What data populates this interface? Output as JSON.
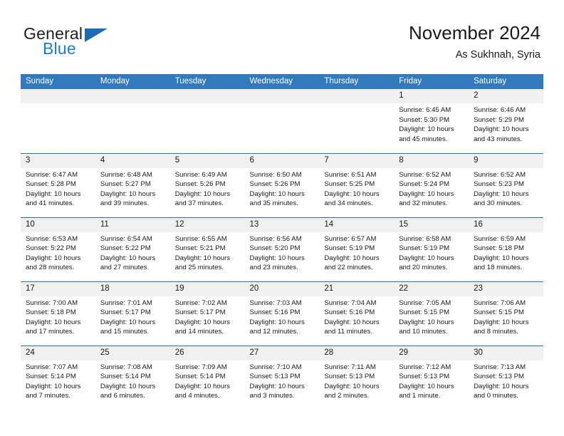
{
  "brand": {
    "word_one": "General",
    "word_two": "Blue",
    "triangle_icon": "blue-triangle-logo"
  },
  "header": {
    "month_title": "November 2024",
    "location": "As Sukhnah, Syria"
  },
  "colors": {
    "header_blue": "#3279bd",
    "daynum_grey": "#f0f0f0",
    "brand_blue": "#1c7fc4",
    "row_border": "#2f73b4"
  },
  "weekday_headers": [
    "Sunday",
    "Monday",
    "Tuesday",
    "Wednesday",
    "Thursday",
    "Friday",
    "Saturday"
  ],
  "weeks": [
    [
      {
        "day": "",
        "sunrise": "",
        "sunset": "",
        "daylight": "",
        "empty": true
      },
      {
        "day": "",
        "sunrise": "",
        "sunset": "",
        "daylight": "",
        "empty": true
      },
      {
        "day": "",
        "sunrise": "",
        "sunset": "",
        "daylight": "",
        "empty": true
      },
      {
        "day": "",
        "sunrise": "",
        "sunset": "",
        "daylight": "",
        "empty": true
      },
      {
        "day": "",
        "sunrise": "",
        "sunset": "",
        "daylight": "",
        "empty": true
      },
      {
        "day": "1",
        "sunrise": "Sunrise: 6:45 AM",
        "sunset": "Sunset: 5:30 PM",
        "daylight": "Daylight: 10 hours and 45 minutes.",
        "empty": false
      },
      {
        "day": "2",
        "sunrise": "Sunrise: 6:46 AM",
        "sunset": "Sunset: 5:29 PM",
        "daylight": "Daylight: 10 hours and 43 minutes.",
        "empty": false
      }
    ],
    [
      {
        "day": "3",
        "sunrise": "Sunrise: 6:47 AM",
        "sunset": "Sunset: 5:28 PM",
        "daylight": "Daylight: 10 hours and 41 minutes.",
        "empty": false
      },
      {
        "day": "4",
        "sunrise": "Sunrise: 6:48 AM",
        "sunset": "Sunset: 5:27 PM",
        "daylight": "Daylight: 10 hours and 39 minutes.",
        "empty": false
      },
      {
        "day": "5",
        "sunrise": "Sunrise: 6:49 AM",
        "sunset": "Sunset: 5:26 PM",
        "daylight": "Daylight: 10 hours and 37 minutes.",
        "empty": false
      },
      {
        "day": "6",
        "sunrise": "Sunrise: 6:50 AM",
        "sunset": "Sunset: 5:26 PM",
        "daylight": "Daylight: 10 hours and 35 minutes.",
        "empty": false
      },
      {
        "day": "7",
        "sunrise": "Sunrise: 6:51 AM",
        "sunset": "Sunset: 5:25 PM",
        "daylight": "Daylight: 10 hours and 34 minutes.",
        "empty": false
      },
      {
        "day": "8",
        "sunrise": "Sunrise: 6:52 AM",
        "sunset": "Sunset: 5:24 PM",
        "daylight": "Daylight: 10 hours and 32 minutes.",
        "empty": false
      },
      {
        "day": "9",
        "sunrise": "Sunrise: 6:52 AM",
        "sunset": "Sunset: 5:23 PM",
        "daylight": "Daylight: 10 hours and 30 minutes.",
        "empty": false
      }
    ],
    [
      {
        "day": "10",
        "sunrise": "Sunrise: 6:53 AM",
        "sunset": "Sunset: 5:22 PM",
        "daylight": "Daylight: 10 hours and 28 minutes.",
        "empty": false
      },
      {
        "day": "11",
        "sunrise": "Sunrise: 6:54 AM",
        "sunset": "Sunset: 5:22 PM",
        "daylight": "Daylight: 10 hours and 27 minutes.",
        "empty": false
      },
      {
        "day": "12",
        "sunrise": "Sunrise: 6:55 AM",
        "sunset": "Sunset: 5:21 PM",
        "daylight": "Daylight: 10 hours and 25 minutes.",
        "empty": false
      },
      {
        "day": "13",
        "sunrise": "Sunrise: 6:56 AM",
        "sunset": "Sunset: 5:20 PM",
        "daylight": "Daylight: 10 hours and 23 minutes.",
        "empty": false
      },
      {
        "day": "14",
        "sunrise": "Sunrise: 6:57 AM",
        "sunset": "Sunset: 5:19 PM",
        "daylight": "Daylight: 10 hours and 22 minutes.",
        "empty": false
      },
      {
        "day": "15",
        "sunrise": "Sunrise: 6:58 AM",
        "sunset": "Sunset: 5:19 PM",
        "daylight": "Daylight: 10 hours and 20 minutes.",
        "empty": false
      },
      {
        "day": "16",
        "sunrise": "Sunrise: 6:59 AM",
        "sunset": "Sunset: 5:18 PM",
        "daylight": "Daylight: 10 hours and 18 minutes.",
        "empty": false
      }
    ],
    [
      {
        "day": "17",
        "sunrise": "Sunrise: 7:00 AM",
        "sunset": "Sunset: 5:18 PM",
        "daylight": "Daylight: 10 hours and 17 minutes.",
        "empty": false
      },
      {
        "day": "18",
        "sunrise": "Sunrise: 7:01 AM",
        "sunset": "Sunset: 5:17 PM",
        "daylight": "Daylight: 10 hours and 15 minutes.",
        "empty": false
      },
      {
        "day": "19",
        "sunrise": "Sunrise: 7:02 AM",
        "sunset": "Sunset: 5:17 PM",
        "daylight": "Daylight: 10 hours and 14 minutes.",
        "empty": false
      },
      {
        "day": "20",
        "sunrise": "Sunrise: 7:03 AM",
        "sunset": "Sunset: 5:16 PM",
        "daylight": "Daylight: 10 hours and 12 minutes.",
        "empty": false
      },
      {
        "day": "21",
        "sunrise": "Sunrise: 7:04 AM",
        "sunset": "Sunset: 5:16 PM",
        "daylight": "Daylight: 10 hours and 11 minutes.",
        "empty": false
      },
      {
        "day": "22",
        "sunrise": "Sunrise: 7:05 AM",
        "sunset": "Sunset: 5:15 PM",
        "daylight": "Daylight: 10 hours and 10 minutes.",
        "empty": false
      },
      {
        "day": "23",
        "sunrise": "Sunrise: 7:06 AM",
        "sunset": "Sunset: 5:15 PM",
        "daylight": "Daylight: 10 hours and 8 minutes.",
        "empty": false
      }
    ],
    [
      {
        "day": "24",
        "sunrise": "Sunrise: 7:07 AM",
        "sunset": "Sunset: 5:14 PM",
        "daylight": "Daylight: 10 hours and 7 minutes.",
        "empty": false
      },
      {
        "day": "25",
        "sunrise": "Sunrise: 7:08 AM",
        "sunset": "Sunset: 5:14 PM",
        "daylight": "Daylight: 10 hours and 6 minutes.",
        "empty": false
      },
      {
        "day": "26",
        "sunrise": "Sunrise: 7:09 AM",
        "sunset": "Sunset: 5:14 PM",
        "daylight": "Daylight: 10 hours and 4 minutes.",
        "empty": false
      },
      {
        "day": "27",
        "sunrise": "Sunrise: 7:10 AM",
        "sunset": "Sunset: 5:13 PM",
        "daylight": "Daylight: 10 hours and 3 minutes.",
        "empty": false
      },
      {
        "day": "28",
        "sunrise": "Sunrise: 7:11 AM",
        "sunset": "Sunset: 5:13 PM",
        "daylight": "Daylight: 10 hours and 2 minutes.",
        "empty": false
      },
      {
        "day": "29",
        "sunrise": "Sunrise: 7:12 AM",
        "sunset": "Sunset: 5:13 PM",
        "daylight": "Daylight: 10 hours and 1 minute.",
        "empty": false
      },
      {
        "day": "30",
        "sunrise": "Sunrise: 7:13 AM",
        "sunset": "Sunset: 5:13 PM",
        "daylight": "Daylight: 10 hours and 0 minutes.",
        "empty": false
      }
    ]
  ]
}
